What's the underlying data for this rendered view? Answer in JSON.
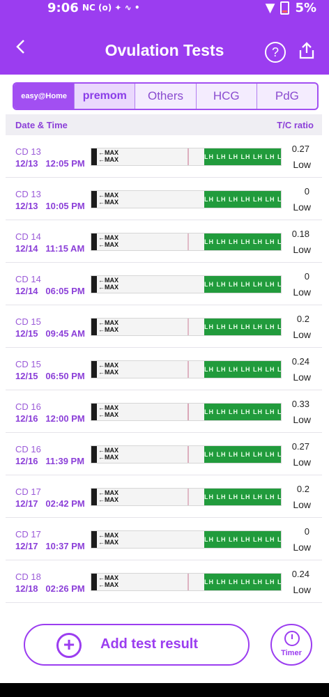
{
  "status": {
    "time": "9:06",
    "left_icons": "NC  (o)  ✦  ∿  •",
    "battery": "5%"
  },
  "header": {
    "title": "Ovulation Tests",
    "back_icon": "chevron-left-icon",
    "help_label": "?",
    "share_icon": "share-icon"
  },
  "tabs": [
    {
      "label": "easy@Home",
      "active": true
    },
    {
      "label": "premom",
      "active": false
    },
    {
      "label": "Others",
      "active": false
    },
    {
      "label": "HCG",
      "active": false
    },
    {
      "label": "PdG",
      "active": false
    }
  ],
  "columns": {
    "left": "Date & Time",
    "right": "T/C ratio"
  },
  "strip_text": {
    "max": "MAX",
    "lh": "LH LH LH LH LH LH LH"
  },
  "rows": [
    {
      "cd": "CD 13",
      "date": "12/13",
      "time": "12:05 PM",
      "ratio": "0.27",
      "level": "Low"
    },
    {
      "cd": "CD 13",
      "date": "12/13",
      "time": "10:05 PM",
      "ratio": "0",
      "level": "Low"
    },
    {
      "cd": "CD 14",
      "date": "12/14",
      "time": "11:15 AM",
      "ratio": "0.18",
      "level": "Low"
    },
    {
      "cd": "CD 14",
      "date": "12/14",
      "time": "06:05 PM",
      "ratio": "0",
      "level": "Low"
    },
    {
      "cd": "CD 15",
      "date": "12/15",
      "time": "09:45 AM",
      "ratio": "0.2",
      "level": "Low"
    },
    {
      "cd": "CD 15",
      "date": "12/15",
      "time": "06:50 PM",
      "ratio": "0.24",
      "level": "Low"
    },
    {
      "cd": "CD 16",
      "date": "12/16",
      "time": "12:00 PM",
      "ratio": "0.33",
      "level": "Low"
    },
    {
      "cd": "CD 16",
      "date": "12/16",
      "time": "11:39 PM",
      "ratio": "0.27",
      "level": "Low"
    },
    {
      "cd": "CD 17",
      "date": "12/17",
      "time": "02:42 PM",
      "ratio": "0.2",
      "level": "Low"
    },
    {
      "cd": "CD 17",
      "date": "12/17",
      "time": "10:37 PM",
      "ratio": "0",
      "level": "Low"
    },
    {
      "cd": "CD 18",
      "date": "12/18",
      "time": "02:26 PM",
      "ratio": "0.24",
      "level": "Low"
    }
  ],
  "buttons": {
    "add_label": "Add test result",
    "timer_label": "Timer"
  },
  "colors": {
    "brand": "#9b3df0",
    "lh_green": "#219b3c"
  }
}
